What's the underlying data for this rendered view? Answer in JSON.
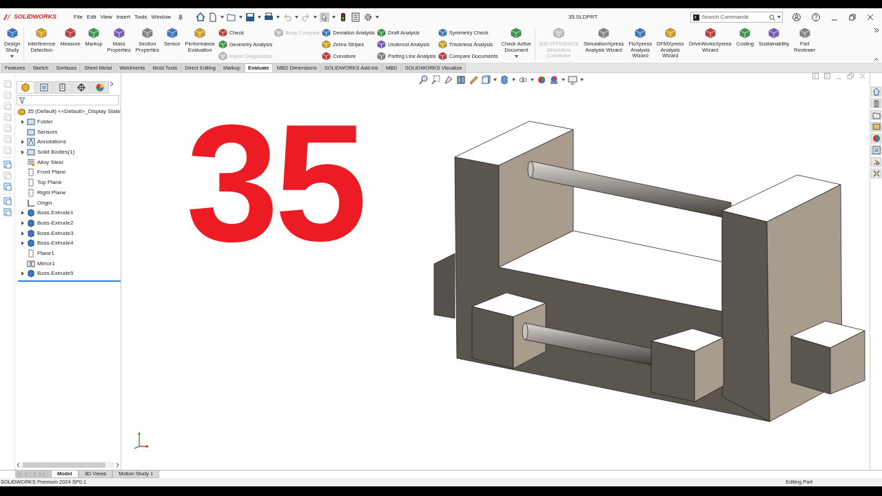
{
  "app": {
    "logo": "SOLIDWORKS",
    "menus": [
      "File",
      "Edit",
      "View",
      "Insert",
      "Tools",
      "Window"
    ],
    "document_title": "35.SLDPRT",
    "search": {
      "placeholder": "Search Commands"
    }
  },
  "ribbon": [
    {
      "kind": "large",
      "label": "Design\nStudy",
      "disabled": false,
      "dropdown": true
    },
    {
      "kind": "separator"
    },
    {
      "kind": "large",
      "label": "Interference\nDetection",
      "disabled": false,
      "dropdown": false
    },
    {
      "kind": "large",
      "label": "Measure",
      "disabled": false,
      "dropdown": false
    },
    {
      "kind": "large",
      "label": "Markup",
      "disabled": false,
      "dropdown": false
    },
    {
      "kind": "large",
      "label": "Mass\nProperties",
      "disabled": false,
      "dropdown": false
    },
    {
      "kind": "large",
      "label": "Section\nProperties",
      "disabled": false,
      "dropdown": false
    },
    {
      "kind": "large",
      "label": "Sensor",
      "disabled": false,
      "dropdown": false
    },
    {
      "kind": "large",
      "label": "Performance\nEvaluation",
      "disabled": false,
      "dropdown": false
    },
    {
      "kind": "stack",
      "items": [
        {
          "label": "Check",
          "disabled": false
        },
        {
          "label": "Geometry Analysis",
          "disabled": false
        },
        {
          "label": "Import Diagnostics",
          "disabled": true
        }
      ]
    },
    {
      "kind": "stack",
      "items": [
        {
          "label": "Body Compare",
          "disabled": true
        }
      ]
    },
    {
      "kind": "stack",
      "items": [
        {
          "label": "Deviation Analysis",
          "disabled": false
        },
        {
          "label": "Zebra Stripes",
          "disabled": false
        },
        {
          "label": "Curvature",
          "disabled": false
        }
      ]
    },
    {
      "kind": "stack",
      "items": [
        {
          "label": "Draft Analysis",
          "disabled": false
        },
        {
          "label": "Undercut Analysis",
          "disabled": false
        },
        {
          "label": "Parting Line Analysis",
          "disabled": false
        }
      ]
    },
    {
      "kind": "stack",
      "items": [
        {
          "label": "Symmetry Check",
          "disabled": false
        },
        {
          "label": "Thickness Analysis",
          "disabled": false
        },
        {
          "label": "Compare Documents",
          "disabled": false
        }
      ]
    },
    {
      "kind": "large",
      "label": "Check Active\nDocument",
      "disabled": false,
      "dropdown": true
    },
    {
      "kind": "separator"
    },
    {
      "kind": "large",
      "label": "3DEXPERIENCE\nSimulation\nConnector",
      "disabled": true,
      "dropdown": false
    },
    {
      "kind": "large",
      "label": "SimulationXpress\nAnalysis Wizard",
      "disabled": false,
      "dropdown": false
    },
    {
      "kind": "large",
      "label": "FloXpress\nAnalysis\nWizard",
      "disabled": false,
      "dropdown": false
    },
    {
      "kind": "large",
      "label": "DFMXpress\nAnalysis\nWizard",
      "disabled": false,
      "dropdown": false
    },
    {
      "kind": "large",
      "label": "DriveWorksXpress\nWizard",
      "disabled": false,
      "dropdown": false
    },
    {
      "kind": "large",
      "label": "Costing",
      "disabled": false,
      "dropdown": false
    },
    {
      "kind": "large",
      "label": "Sustainability",
      "disabled": false,
      "dropdown": false
    },
    {
      "kind": "large",
      "label": "Part\nReviewer",
      "disabled": false,
      "dropdown": false
    }
  ],
  "tabs": [
    {
      "label": "Features",
      "selected": false
    },
    {
      "label": "Sketch",
      "selected": false
    },
    {
      "label": "Surfaces",
      "selected": false
    },
    {
      "label": "Sheet Metal",
      "selected": false
    },
    {
      "label": "Weldments",
      "selected": false
    },
    {
      "label": "Mold Tools",
      "selected": false
    },
    {
      "label": "Direct Editing",
      "selected": false
    },
    {
      "label": "Markup",
      "selected": false
    },
    {
      "label": "Evaluate",
      "selected": true
    },
    {
      "label": "MBD Dimensions",
      "selected": false
    },
    {
      "label": "SOLIDWORKS Add-Ins",
      "selected": false
    },
    {
      "label": "MBD",
      "selected": false
    },
    {
      "label": "SOLIDWORKS Visualize",
      "selected": false
    }
  ],
  "tree": {
    "root": "35 (Default) <<Default>_Display State",
    "items": [
      {
        "label": "Folder",
        "kind": "folder",
        "expandable": true
      },
      {
        "label": "Sensors",
        "kind": "folder",
        "expandable": false
      },
      {
        "label": "Annotations",
        "kind": "annotation",
        "expandable": true
      },
      {
        "label": "Solid Bodies(1)",
        "kind": "folder",
        "expandable": true
      },
      {
        "label": "Alloy Steel",
        "kind": "material",
        "expandable": false
      },
      {
        "label": "Front Plane",
        "kind": "plane",
        "expandable": false
      },
      {
        "label": "Top Plane",
        "kind": "plane",
        "expandable": false
      },
      {
        "label": "Right Plane",
        "kind": "plane",
        "expandable": false
      },
      {
        "label": "Origin",
        "kind": "origin",
        "expandable": false
      },
      {
        "label": "Boss-Extrude1",
        "kind": "feature",
        "expandable": true
      },
      {
        "label": "Boss-Extrude2",
        "kind": "feature",
        "expandable": true
      },
      {
        "label": "Boss-Extrude3",
        "kind": "feature",
        "expandable": true
      },
      {
        "label": "Boss-Extrude4",
        "kind": "feature",
        "expandable": true
      },
      {
        "label": "Plane1",
        "kind": "plane",
        "expandable": false
      },
      {
        "label": "Mirror1",
        "kind": "mirror",
        "expandable": false
      },
      {
        "label": "Boss-Extrude5",
        "kind": "feature",
        "expandable": true
      }
    ]
  },
  "viewport": {
    "overlay_text": "35"
  },
  "bottom_tabs": [
    {
      "label": "Model",
      "selected": true
    },
    {
      "label": "3D Views",
      "selected": false
    },
    {
      "label": "Motion Study 1",
      "selected": false
    }
  ],
  "status_bar": {
    "product": "SOLIDWORKS Premium 2024 SP0.1",
    "mode": "Editing Part"
  }
}
